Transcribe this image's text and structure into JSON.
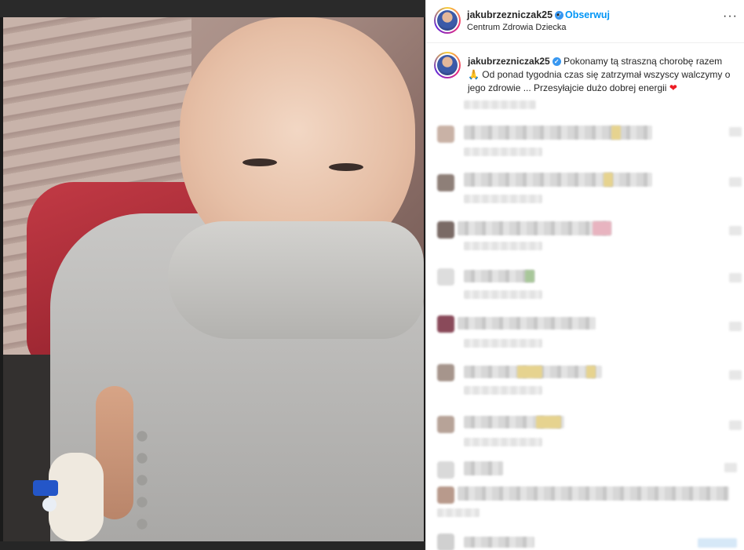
{
  "post": {
    "author": "jakubrzezniczak25",
    "follow_label": "Obserwuj",
    "separator": "•",
    "location": "Centrum Zdrowia Dziecka",
    "more_label": "···",
    "verified_glyph": "✓",
    "caption_author": "jakubrzezniczak25",
    "caption_text": "Pokonamy tą straszną chorobę razem 🙏 Od ponad tygodnia czas się zatrzymał wszyscy walczymy o jego zdrowie ... Przesyłajcie dużo dobrej energii",
    "caption_heart": "❤",
    "image_alt": "photo"
  },
  "colors": {
    "follow": "#0095f6",
    "verified": "#3897f0",
    "heart": "#ed1c24"
  },
  "icons": {
    "verified": "verified-badge-icon",
    "more": "more-options-icon",
    "heart": "heart-icon"
  }
}
